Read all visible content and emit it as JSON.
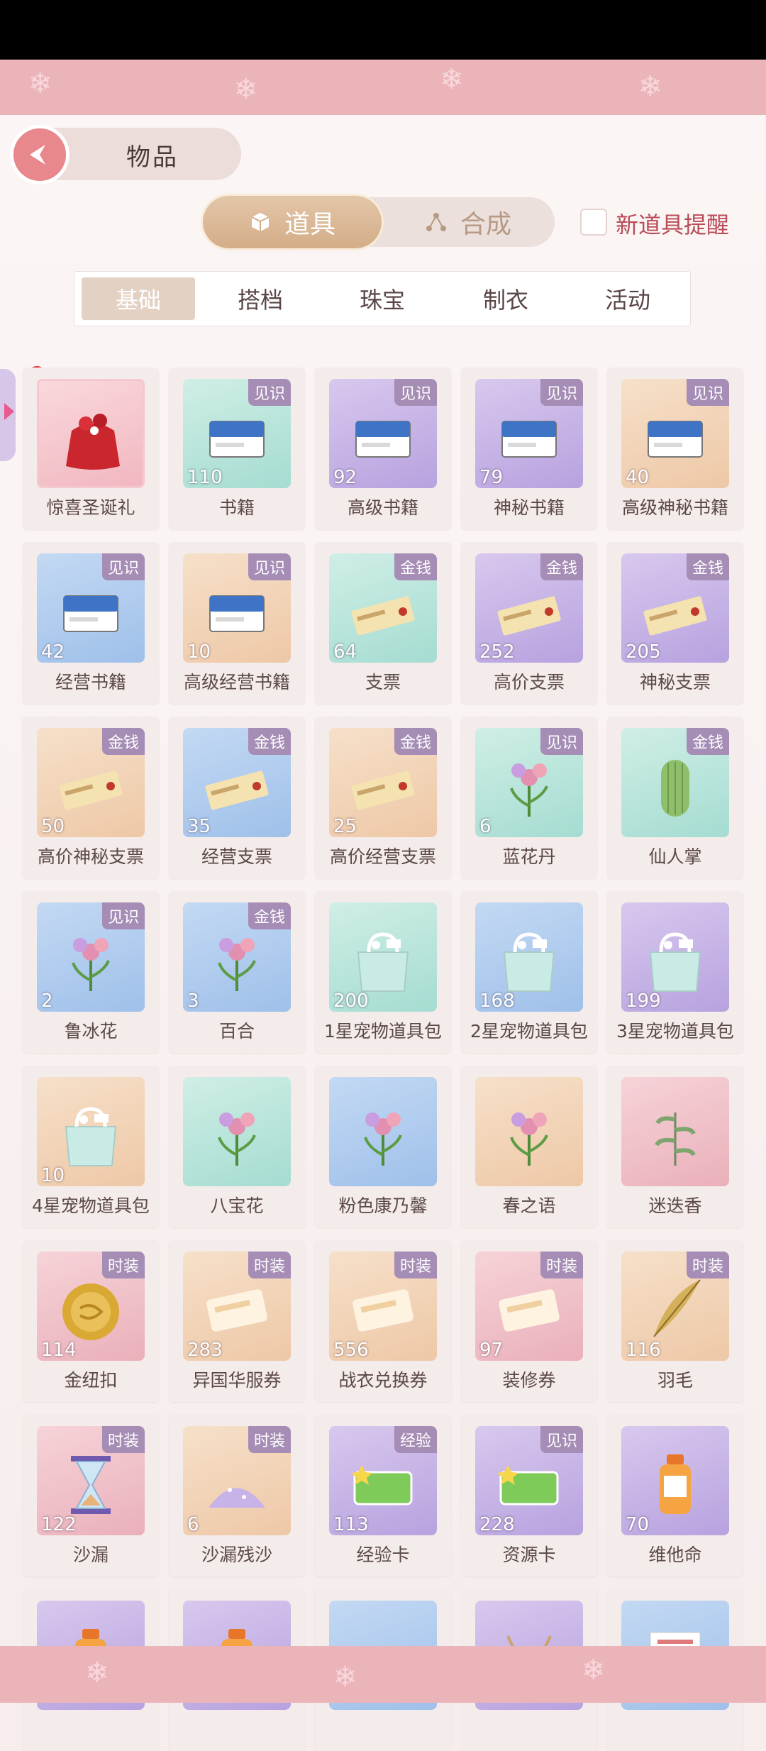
{
  "header": {
    "title": "物品"
  },
  "tabs": {
    "active": "道具",
    "inactive": "合成"
  },
  "notify": {
    "label": "新道具提醒"
  },
  "subtabs": [
    "基础",
    "搭档",
    "珠宝",
    "制衣",
    "活动"
  ],
  "items": [
    {
      "name": "惊喜圣诞礼",
      "count": "",
      "tag": "",
      "color": "gift",
      "icon": "gift-bag-icon"
    },
    {
      "name": "书籍",
      "count": "110",
      "tag": "见识",
      "color": "green",
      "icon": "book-icon"
    },
    {
      "name": "高级书籍",
      "count": "92",
      "tag": "见识",
      "color": "purple",
      "icon": "book-icon"
    },
    {
      "name": "神秘书籍",
      "count": "79",
      "tag": "见识",
      "color": "purple",
      "icon": "book-icon"
    },
    {
      "name": "高级神秘书籍",
      "count": "40",
      "tag": "见识",
      "color": "orange",
      "icon": "book-icon"
    },
    {
      "name": "经营书籍",
      "count": "42",
      "tag": "见识",
      "color": "blue",
      "icon": "book-icon"
    },
    {
      "name": "高级经营书籍",
      "count": "10",
      "tag": "见识",
      "color": "orange",
      "icon": "book-icon"
    },
    {
      "name": "支票",
      "count": "64",
      "tag": "金钱",
      "color": "green",
      "icon": "cheque-icon"
    },
    {
      "name": "高价支票",
      "count": "252",
      "tag": "金钱",
      "color": "purple",
      "icon": "cheque-icon"
    },
    {
      "name": "神秘支票",
      "count": "205",
      "tag": "金钱",
      "color": "purple",
      "icon": "cheque-icon"
    },
    {
      "name": "高价神秘支票",
      "count": "50",
      "tag": "金钱",
      "color": "orange",
      "icon": "cheque-icon"
    },
    {
      "name": "经营支票",
      "count": "35",
      "tag": "金钱",
      "color": "blue",
      "icon": "cheque-icon"
    },
    {
      "name": "高价经营支票",
      "count": "25",
      "tag": "金钱",
      "color": "orange",
      "icon": "cheque-icon"
    },
    {
      "name": "蓝花丹",
      "count": "6",
      "tag": "见识",
      "color": "green",
      "icon": "flower-icon"
    },
    {
      "name": "仙人掌",
      "count": "",
      "tag": "金钱",
      "color": "green",
      "icon": "cactus-icon"
    },
    {
      "name": "鲁冰花",
      "count": "2",
      "tag": "见识",
      "color": "blue",
      "icon": "flower-icon"
    },
    {
      "name": "百合",
      "count": "3",
      "tag": "金钱",
      "color": "blue",
      "icon": "flower-icon"
    },
    {
      "name": "1星宠物道具包",
      "count": "200",
      "tag": "",
      "color": "green",
      "icon": "bag-icon"
    },
    {
      "name": "2星宠物道具包",
      "count": "168",
      "tag": "",
      "color": "blue",
      "icon": "bag-icon"
    },
    {
      "name": "3星宠物道具包",
      "count": "199",
      "tag": "",
      "color": "purple",
      "icon": "bag-icon"
    },
    {
      "name": "4星宠物道具包",
      "count": "10",
      "tag": "",
      "color": "orange",
      "icon": "bag-icon"
    },
    {
      "name": "八宝花",
      "count": "",
      "tag": "",
      "color": "green",
      "icon": "flower-icon"
    },
    {
      "name": "粉色康乃馨",
      "count": "",
      "tag": "",
      "color": "blue",
      "icon": "flower-icon"
    },
    {
      "name": "春之语",
      "count": "",
      "tag": "",
      "color": "orange",
      "icon": "flower-icon"
    },
    {
      "name": "迷迭香",
      "count": "",
      "tag": "",
      "color": "pink",
      "icon": "herb-icon"
    },
    {
      "name": "金纽扣",
      "count": "114",
      "tag": "时装",
      "color": "pink",
      "icon": "coin-icon"
    },
    {
      "name": "异国华服券",
      "count": "283",
      "tag": "时装",
      "color": "orange",
      "icon": "ticket-icon"
    },
    {
      "name": "战衣兑换券",
      "count": "556",
      "tag": "时装",
      "color": "orange",
      "icon": "ticket-icon"
    },
    {
      "name": "装修券",
      "count": "97",
      "tag": "时装",
      "color": "pink",
      "icon": "ticket-icon"
    },
    {
      "name": "羽毛",
      "count": "116",
      "tag": "时装",
      "color": "orange",
      "icon": "feather-icon"
    },
    {
      "name": "沙漏",
      "count": "122",
      "tag": "时装",
      "color": "pink",
      "icon": "hourglass-icon"
    },
    {
      "name": "沙漏残沙",
      "count": "6",
      "tag": "时装",
      "color": "orange",
      "icon": "sand-icon"
    },
    {
      "name": "经验卡",
      "count": "113",
      "tag": "经验",
      "color": "purple",
      "icon": "card-icon"
    },
    {
      "name": "资源卡",
      "count": "228",
      "tag": "见识",
      "color": "purple",
      "icon": "card-icon"
    },
    {
      "name": "维他命",
      "count": "70",
      "tag": "",
      "color": "purple",
      "icon": "bottle-icon"
    }
  ],
  "partial_items": [
    {
      "color": "purple",
      "icon": "bottle-icon"
    },
    {
      "color": "purple",
      "icon": "bottle-icon"
    },
    {
      "color": "blue",
      "icon": "ice-icon"
    },
    {
      "color": "purple",
      "icon": "necklace-icon"
    },
    {
      "color": "blue",
      "icon": "document-icon"
    }
  ]
}
